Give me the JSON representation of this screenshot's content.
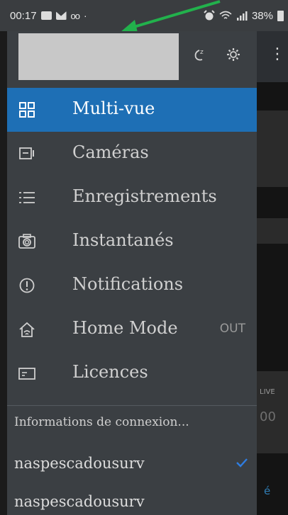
{
  "status_bar": {
    "time": "00:17",
    "battery": "38%",
    "voicemail_glyph": "ᴏᴏ",
    "dot": "·",
    "icons": [
      "image-icon",
      "mail-icon",
      "voicemail-icon",
      "alarm-icon",
      "wifi-icon",
      "signal-icon",
      "battery-icon"
    ]
  },
  "drawer": {
    "header": {
      "icons": [
        "sleep-icon",
        "settings-icon"
      ]
    },
    "menu": [
      {
        "label": "Multi-vue",
        "icon": "grid-icon",
        "active": true
      },
      {
        "label": "Caméras",
        "icon": "camera-icon",
        "active": false
      },
      {
        "label": "Enregistrements",
        "icon": "list-icon",
        "active": false
      },
      {
        "label": "Instantanés",
        "icon": "snapshot-icon",
        "active": false
      },
      {
        "label": "Notifications",
        "icon": "alert-icon",
        "active": false
      },
      {
        "label": "Home Mode",
        "icon": "home-icon",
        "active": false,
        "badge": "OUT"
      },
      {
        "label": "Licences",
        "icon": "license-icon",
        "active": false
      }
    ],
    "connection_section": {
      "title": "Informations de connexion...",
      "accounts": [
        {
          "name": "naspescadousurv",
          "selected": true
        },
        {
          "name": "naspescadousurv",
          "selected": false
        }
      ]
    }
  },
  "background_app": {
    "overflow_icon": "⋮",
    "live_text": "LIVE",
    "time_text": "00",
    "accent_text": "é"
  },
  "colors": {
    "active_item": "#1e6fb5",
    "drawer_bg": "#3b3f43",
    "check": "#2f7de1",
    "annotation_arrow": "#22b14c"
  }
}
